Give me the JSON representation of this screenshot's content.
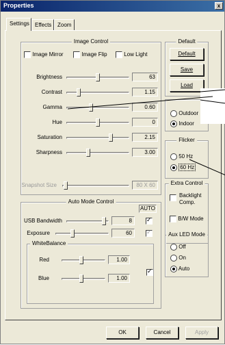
{
  "window": {
    "title": "Properties",
    "close_glyph": "x"
  },
  "tabs": [
    "Settings",
    "Effects",
    "Zoom"
  ],
  "image_control": {
    "title": "Image Control",
    "checkboxes": [
      {
        "label": "Image Mirror",
        "checked": false
      },
      {
        "label": "Image Flip",
        "checked": false
      },
      {
        "label": "Low Light",
        "checked": false
      }
    ],
    "sliders": [
      {
        "label": "Brightness",
        "value": "63",
        "position": 0.5
      },
      {
        "label": "Contrast",
        "value": "1.15",
        "position": 0.18
      },
      {
        "label": "Gamma",
        "value": "0.60",
        "position": 0.38
      },
      {
        "label": "Hue",
        "value": "0",
        "position": 0.5
      },
      {
        "label": "Saturation",
        "value": "2.15",
        "position": 0.72
      },
      {
        "label": "Sharpness",
        "value": "3.00",
        "position": 0.34
      }
    ],
    "snapshot": {
      "label": "Snapshot Size",
      "value": "80 X 60",
      "position": 0.02,
      "enabled": false
    }
  },
  "default_group": {
    "title": "Default",
    "buttons": [
      "Default",
      "Save",
      "Load"
    ]
  },
  "light_group": {
    "options": [
      "Outdoor",
      "Indoor"
    ],
    "selected": "Indoor"
  },
  "flicker": {
    "title": "Flicker",
    "options": [
      "50 Hz",
      "60 Hz"
    ],
    "selected": "60 Hz"
  },
  "auto_mode": {
    "title": "Auto Mode Control",
    "auto_label": "AUTO",
    "usb": {
      "label": "USB Bandwidth",
      "value": "8",
      "position": 0.93,
      "auto": true
    },
    "exposure": {
      "label": "Exposure",
      "value": "60",
      "position": 0.3,
      "auto": true
    },
    "white_balance": {
      "title": "WhiteBalance",
      "red": {
        "label": "Red",
        "value": "1.00",
        "position": 0.45
      },
      "blue": {
        "label": "Blue",
        "value": "1.00",
        "position": 0.45
      },
      "auto": true
    }
  },
  "extra_control": {
    "title": "Extra Control",
    "options": [
      {
        "label": "Backlight Comp.",
        "checked": false
      },
      {
        "label": "B/W Mode",
        "checked": false
      }
    ]
  },
  "aux_led": {
    "title": "Aux LED Mode",
    "options": [
      "Off",
      "On",
      "Auto"
    ],
    "selected": "Auto"
  },
  "footer": {
    "ok": "OK",
    "cancel": "Cancel",
    "apply": "Apply"
  }
}
